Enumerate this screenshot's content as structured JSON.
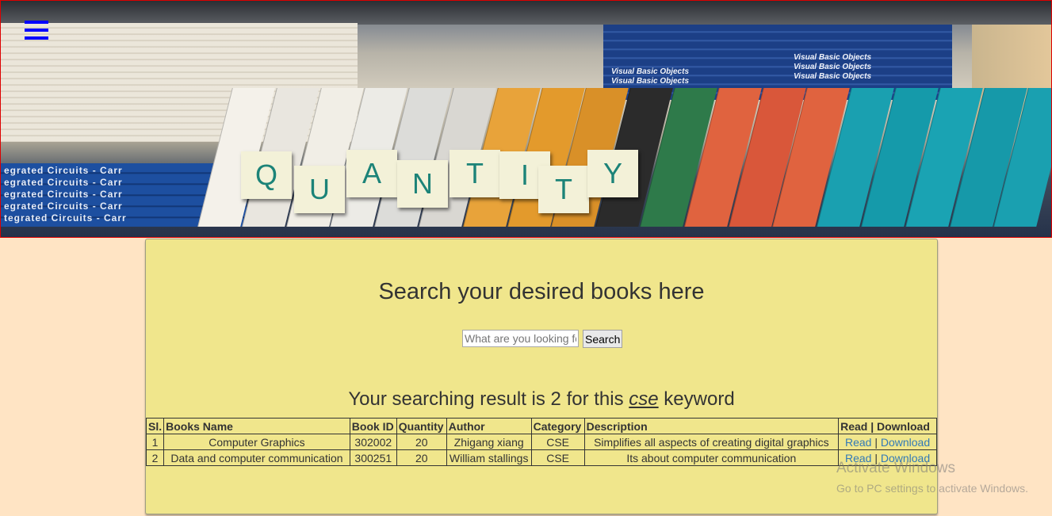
{
  "banner": {
    "tiles": [
      "Q",
      "U",
      "A",
      "N",
      "T",
      "I",
      "T",
      "Y"
    ],
    "circuit_lines": [
      "egrated Circuits - Carr",
      "egrated Circuits - Carr",
      "egrated Circuits - Carr",
      "egrated Circuits - Carr",
      "tegrated Circuits - Carr"
    ],
    "vb_lines": [
      "Visual Basic Objects",
      "Visual Basic Objects",
      "Visual Basic Objects",
      "Visual Basic Objects",
      "Visual Basic Objects"
    ]
  },
  "search": {
    "heading": "Search your desired books here",
    "placeholder": "What are you looking for?",
    "button": "Search"
  },
  "result": {
    "prefix": "Your searching result is 2 for this ",
    "keyword": "cse",
    "suffix": " keyword"
  },
  "table": {
    "headers": [
      "Sl.",
      "Books Name",
      "Book ID",
      "Quantity",
      "Author",
      "Category",
      "Description",
      "Read | Download"
    ],
    "rows": [
      {
        "sl": "1",
        "name": "Computer Graphics",
        "id": "302002",
        "qty": "20",
        "author": "Zhigang xiang",
        "category": "CSE",
        "description": "Simplifies all aspects of creating digital graphics",
        "read": "Read",
        "sep": "|",
        "download": "Download"
      },
      {
        "sl": "2",
        "name": "Data and computer communication",
        "id": "300251",
        "qty": "20",
        "author": "William stallings",
        "category": "CSE",
        "description": "Its about computer communication",
        "read": "Read",
        "sep": "|",
        "download": "Download"
      }
    ]
  },
  "watermark": {
    "line1": "Activate Windows",
    "line2": "Go to PC settings to activate Windows."
  }
}
